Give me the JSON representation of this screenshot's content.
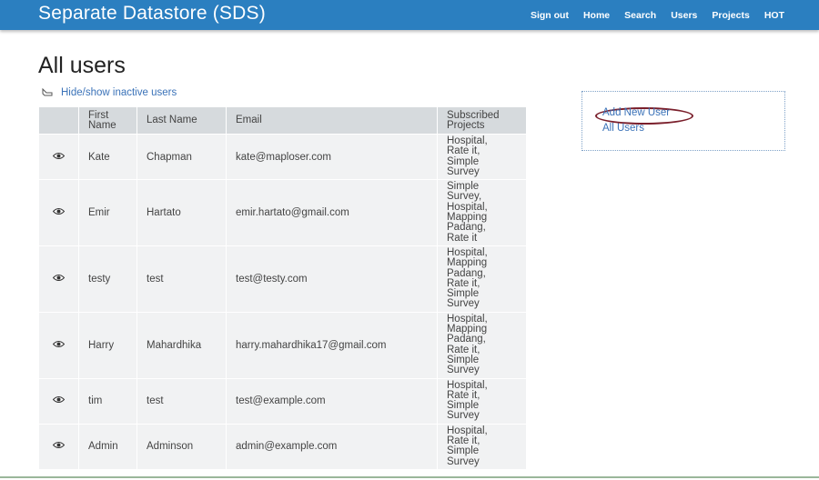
{
  "header": {
    "brand": "Separate Datastore (SDS)",
    "nav": [
      "Sign out",
      "Home",
      "Search",
      "Users",
      "Projects",
      "HOT"
    ]
  },
  "main": {
    "title": "All users",
    "toggle_link": "Hide/show inactive users",
    "columns": [
      "First Name",
      "Last Name",
      "Email",
      "Subscribed Projects"
    ],
    "rows": [
      {
        "first": "Kate",
        "last": "Chapman",
        "email": "kate@maploser.com",
        "projects": [
          "Hospital,",
          "Rate it,",
          "Simple",
          "Survey"
        ]
      },
      {
        "first": "Emir",
        "last": "Hartato",
        "email": "emir.hartato@gmail.com",
        "projects": [
          "Simple",
          "Survey,",
          "Hospital,",
          "Mapping",
          "Padang,",
          "Rate it"
        ]
      },
      {
        "first": "testy",
        "last": "test",
        "email": "test@testy.com",
        "projects": [
          "Hospital,",
          "Mapping",
          "Padang,",
          "Rate it,",
          "Simple",
          "Survey"
        ]
      },
      {
        "first": "Harry",
        "last": "Mahardhika",
        "email": "harry.mahardhika17@gmail.com",
        "projects": [
          "Hospital,",
          "Mapping",
          "Padang,",
          "Rate it,",
          "Simple",
          "Survey"
        ]
      },
      {
        "first": "tim",
        "last": "test",
        "email": "test@example.com",
        "projects": [
          "Hospital,",
          "Rate it,",
          "Simple",
          "Survey"
        ]
      },
      {
        "first": "Admin",
        "last": "Adminson",
        "email": "admin@example.com",
        "projects": [
          "Hospital,",
          "Rate it,",
          "Simple",
          "Survey"
        ]
      }
    ]
  },
  "sidebar": {
    "links": [
      "Add New User",
      "All Users"
    ]
  },
  "colors": {
    "topbar": "#2b7fc0",
    "link": "#3a72b8",
    "header_cell": "#d6dadd",
    "body_cell": "#f1f2f3",
    "annotation_circle": "#7a1f2b"
  },
  "icons": {
    "row_view": "eye-icon",
    "toggle": "hand-pointer-icon"
  }
}
